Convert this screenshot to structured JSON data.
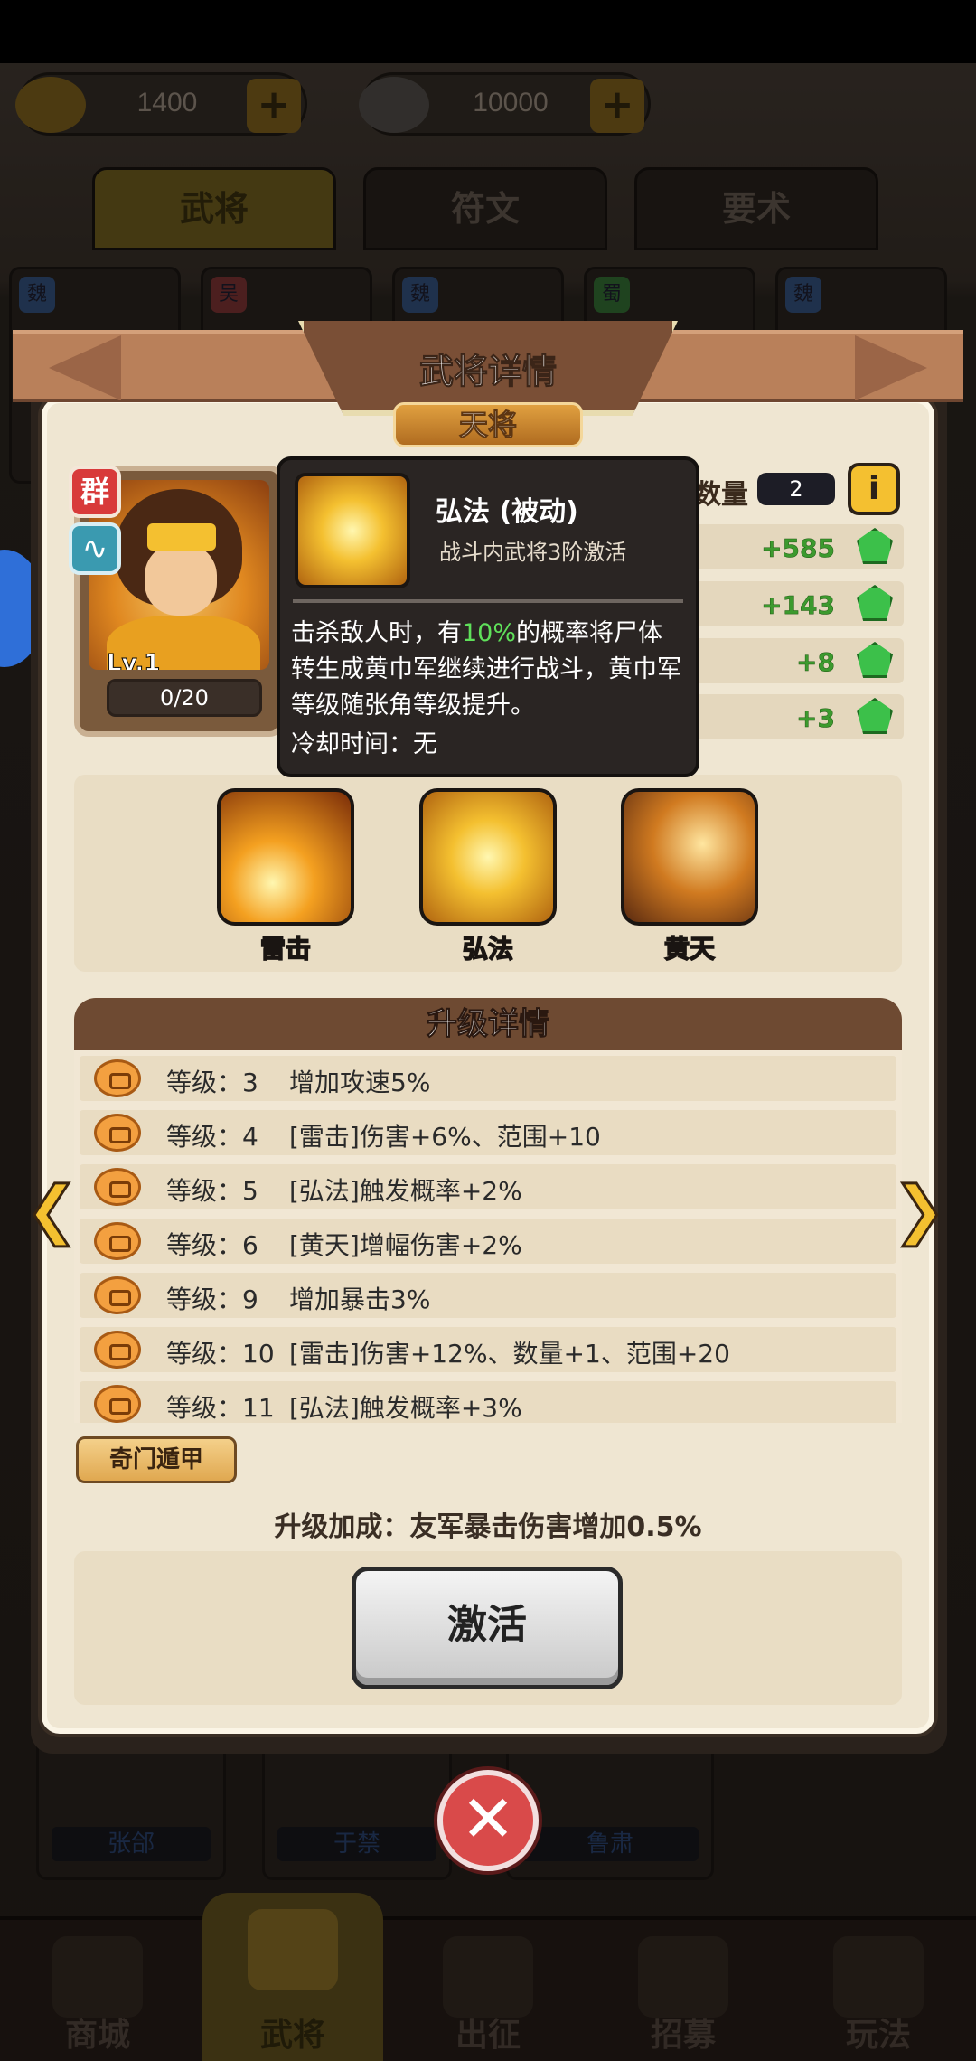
{
  "currency": {
    "gold": {
      "value": "1400",
      "icon": "gold-ingot-icon"
    },
    "coins": {
      "value": "10000",
      "icon": "copper-coin-icon"
    },
    "plus": "+"
  },
  "top_tabs": [
    {
      "label": "武将",
      "active": true
    },
    {
      "label": "符文",
      "active": false
    },
    {
      "label": "要术",
      "active": false
    }
  ],
  "background_cards": {
    "faction_badges": [
      "魏",
      "吴",
      "魏",
      "蜀",
      "魏"
    ],
    "bottom_names": [
      "张郃",
      "于禁",
      "鲁肃"
    ]
  },
  "modal": {
    "title": "武将详情",
    "rank": "天将",
    "hero": {
      "faction": "群",
      "level": "Lv.1",
      "progress": "0/20"
    },
    "count_label": "数量",
    "count_value": "2",
    "info_icon": "i",
    "stats": [
      {
        "value": "+585"
      },
      {
        "value": "+143"
      },
      {
        "value": "+8"
      },
      {
        "value": "+3"
      }
    ],
    "tooltip": {
      "title": "弘法 (被动)",
      "subtitle": "战斗内武将3阶激活",
      "body_before": "击杀敌人时，有",
      "body_highlight": "10%",
      "body_after": "的概率将尸体转生成黄巾军继续进行战斗，黄巾军等级随张角等级提升。",
      "cooldown": "冷却时间：无"
    },
    "skills": [
      {
        "name": "雷击",
        "icon": "lightning-skill-icon"
      },
      {
        "name": "弘法",
        "icon": "hongfa-skill-icon"
      },
      {
        "name": "黄天",
        "icon": "huangtian-skill-icon"
      }
    ],
    "upgrade_header": "升级详情",
    "upgrades": [
      {
        "level": "等级：3",
        "desc": "增加攻速5%"
      },
      {
        "level": "等级：4",
        "desc": "[雷击]伤害+6%、范围+10"
      },
      {
        "level": "等级：5",
        "desc": "[弘法]触发概率+2%"
      },
      {
        "level": "等级：6",
        "desc": "[黄天]增幅伤害+2%"
      },
      {
        "level": "等级：9",
        "desc": "增加暴击3%"
      },
      {
        "level": "等级：10",
        "desc": "[雷击]伤害+12%、数量+1、范围+20"
      },
      {
        "level": "等级：11",
        "desc": "[弘法]触发概率+3%"
      }
    ],
    "qimen_button": "奇门遁甲",
    "bonus_text": "升级加成：友军暴击伤害增加0.5%",
    "activate_button": "激活",
    "close_icon": "✕"
  },
  "bottom_nav": [
    {
      "label": "商城",
      "active": false
    },
    {
      "label": "武将",
      "active": true
    },
    {
      "label": "出征",
      "active": false
    },
    {
      "label": "招募",
      "active": false
    },
    {
      "label": "玩法",
      "active": false
    }
  ]
}
